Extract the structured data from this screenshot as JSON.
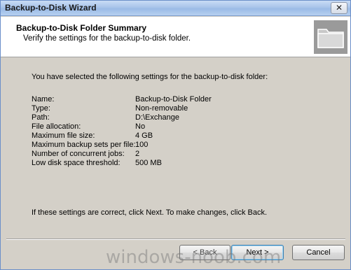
{
  "window": {
    "title": "Backup-to-Disk Wizard",
    "close_glyph": "✕"
  },
  "header": {
    "title": "Backup-to-Disk Folder Summary",
    "subtitle": "Verify the settings for the backup-to-disk folder.",
    "icon": "folder-icon"
  },
  "content": {
    "intro": "You have selected the following settings for the backup-to-disk folder:",
    "settings": [
      {
        "label": "Name:",
        "value": "Backup-to-Disk Folder"
      },
      {
        "label": "Type:",
        "value": "Non-removable"
      },
      {
        "label": "Path:",
        "value": "D:\\Exchange"
      },
      {
        "label": "File allocation:",
        "value": "No"
      },
      {
        "label": "Maximum file size:",
        "value": "4 GB"
      },
      {
        "label": "Maximum backup sets per file:",
        "value": "100"
      },
      {
        "label": "Number of concurrent jobs:",
        "value": "2"
      },
      {
        "label": "Low disk space threshold:",
        "value": "500 MB"
      }
    ],
    "footer": "If these settings are correct, click Next.  To make changes, click Back."
  },
  "buttons": {
    "back": "< Back",
    "next": "Next >",
    "cancel": "Cancel"
  },
  "watermark": "windows-noob.com"
}
